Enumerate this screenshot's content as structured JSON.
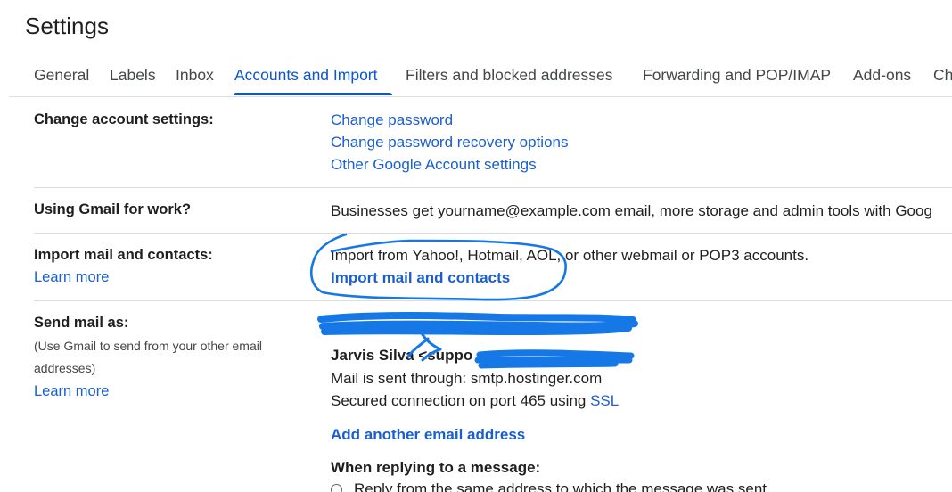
{
  "page_title": "Settings",
  "tabs": [
    {
      "label": "General"
    },
    {
      "label": "Labels"
    },
    {
      "label": "Inbox"
    },
    {
      "label": "Accounts and Import",
      "active": true
    },
    {
      "label": "Filters and blocked addresses"
    },
    {
      "label": "Forwarding and POP/IMAP"
    },
    {
      "label": "Add-ons"
    },
    {
      "label": "Ch"
    }
  ],
  "sections": {
    "change_account": {
      "label": "Change account settings:",
      "links": [
        "Change password",
        "Change password recovery options",
        "Other Google Account settings"
      ]
    },
    "gmail_for_work": {
      "label": "Using Gmail for work?",
      "text": "Businesses get yourname@example.com email, more storage and admin tools with Goog"
    },
    "import_mail": {
      "label": "Import mail and contacts:",
      "learn_more": "Learn more",
      "text": "Import from Yahoo!, Hotmail, AOL, or other webmail or POP3 accounts.",
      "action": "Import mail and contacts"
    },
    "send_mail_as": {
      "label": "Send mail as:",
      "sublabel_line1": "(Use Gmail to send from your other email",
      "sublabel_line2": "addresses)",
      "learn_more": "Learn more",
      "account1_name": "Jarvis Silva <suppo",
      "sent_through": "Mail is sent through: smtp.hostinger.com",
      "secured_prefix": "Secured connection on port 465 using ",
      "secured_link": "SSL",
      "add_address": "Add another email address",
      "replying_heading": "When replying to a message:",
      "reply_option": "Reply from the same address to which the message was sent"
    }
  },
  "colors": {
    "accent": "#0b57d0",
    "link": "#1a5ed1",
    "scribble": "#1677e6"
  }
}
